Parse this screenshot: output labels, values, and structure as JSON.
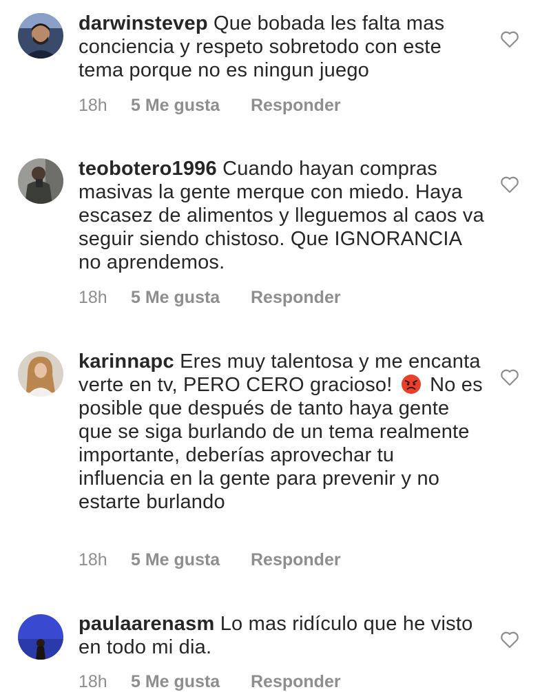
{
  "comments": [
    {
      "username": "darwinstevep",
      "text": "Que bobada les falta mas conciencia y respeto sobretodo con este tema porque no es ningun juego",
      "time": "18h",
      "likes": "5 Me gusta",
      "reply": "Responder",
      "like_icon": "heart-outline-icon"
    },
    {
      "username": "teobotero1996",
      "text": "Cuando hayan compras masivas la gente merque con miedo. Haya escasez de alimentos y lleguemos al caos va seguir siendo chistoso. Que IGNORANCIA no aprendemos.",
      "time": "18h",
      "likes": "5 Me gusta",
      "reply": "Responder",
      "like_icon": "heart-outline-icon"
    },
    {
      "username": "karinnapc",
      "text_before_emoji": "Eres muy talentosa y me encanta verte en tv, PERO CERO gracioso!",
      "emoji": "angry-face-emoji",
      "text_after_emoji": "No es posible que después de tanto haya gente que se siga burlando de un tema realmente importante, deberías aprovechar tu influencia en la gente para prevenir y no estarte burlando",
      "time": "18h",
      "likes": "5 Me gusta",
      "reply": "Responder",
      "like_icon": "heart-outline-icon"
    },
    {
      "username": "paulaarenasm",
      "text": "Lo mas ridículo que he visto en todo mi dia.",
      "time": "18h",
      "likes": "5 Me gusta",
      "reply": "Responder",
      "like_icon": "heart-outline-icon"
    }
  ],
  "colors": {
    "text": "#262626",
    "meta": "#8e8e8e",
    "background": "#ffffff"
  }
}
